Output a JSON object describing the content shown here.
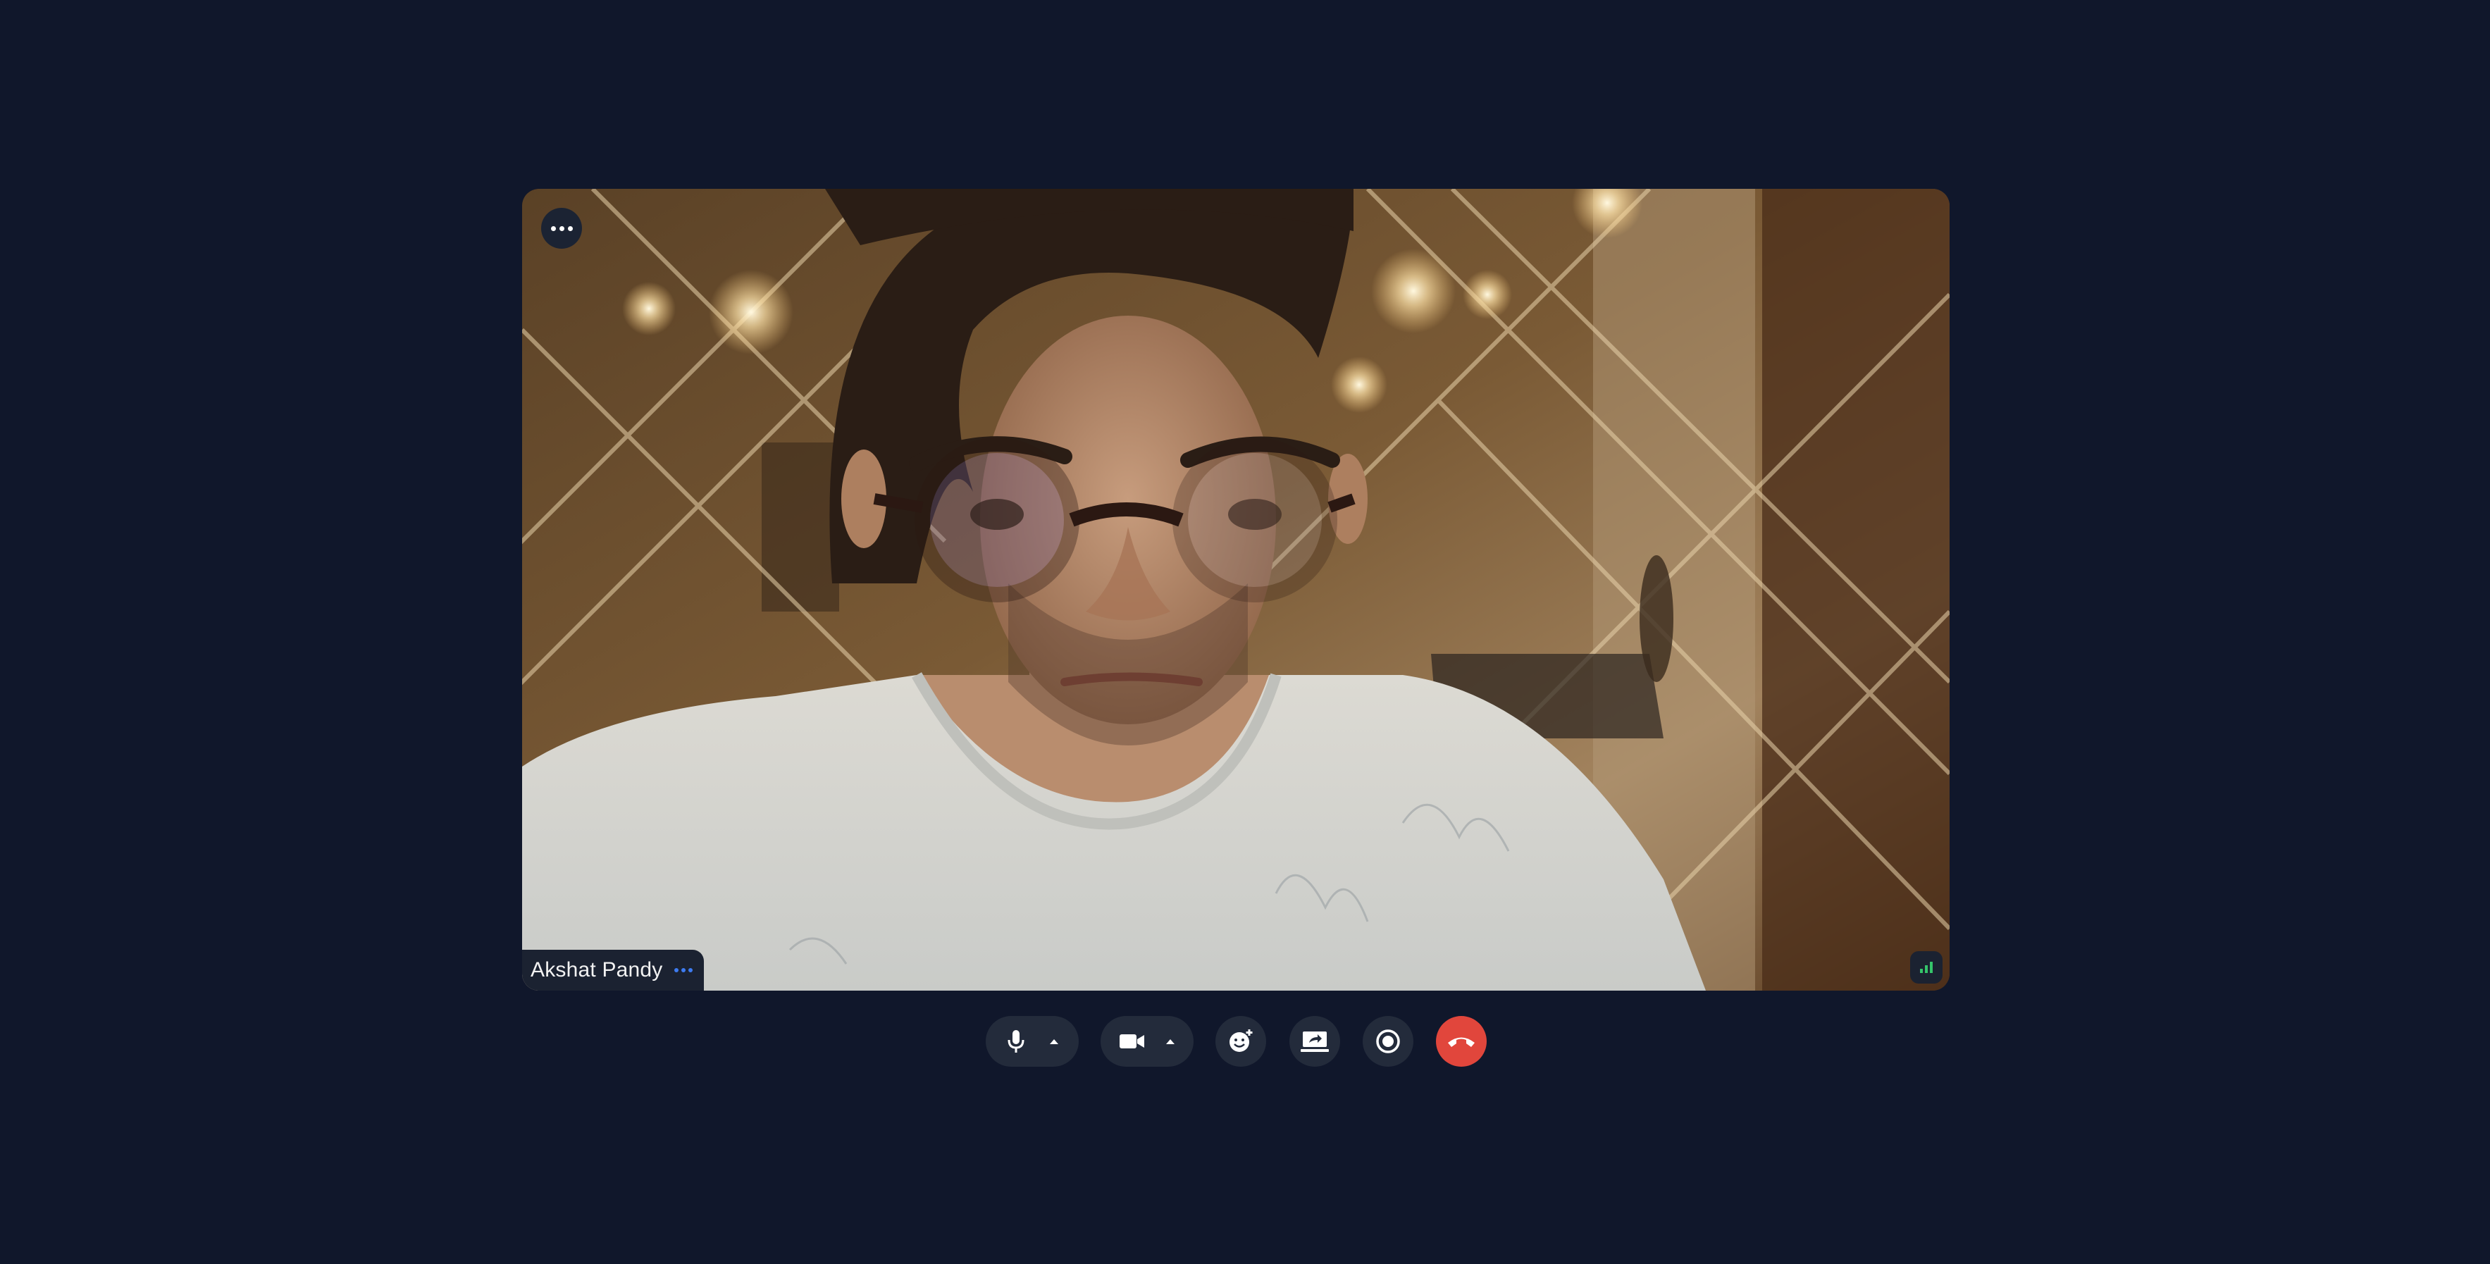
{
  "participant": {
    "name": "Akshat Pandy"
  },
  "icons": {
    "tile_menu": "more-horizontal-icon",
    "name_options": "more-horizontal-icon",
    "signal": "signal-bars-icon",
    "mic": "microphone-icon",
    "mic_options": "caret-up-icon",
    "camera": "video-camera-icon",
    "camera_options": "caret-up-icon",
    "reactions": "emoji-add-icon",
    "share": "screen-share-icon",
    "record": "record-icon",
    "hangup": "phone-hangup-icon"
  },
  "colors": {
    "background": "#10172b",
    "control_bg": "#232b3b",
    "hangup": "#e1463c",
    "name_dots": "#3d7bf0",
    "signal_bars": "#35c46a"
  }
}
